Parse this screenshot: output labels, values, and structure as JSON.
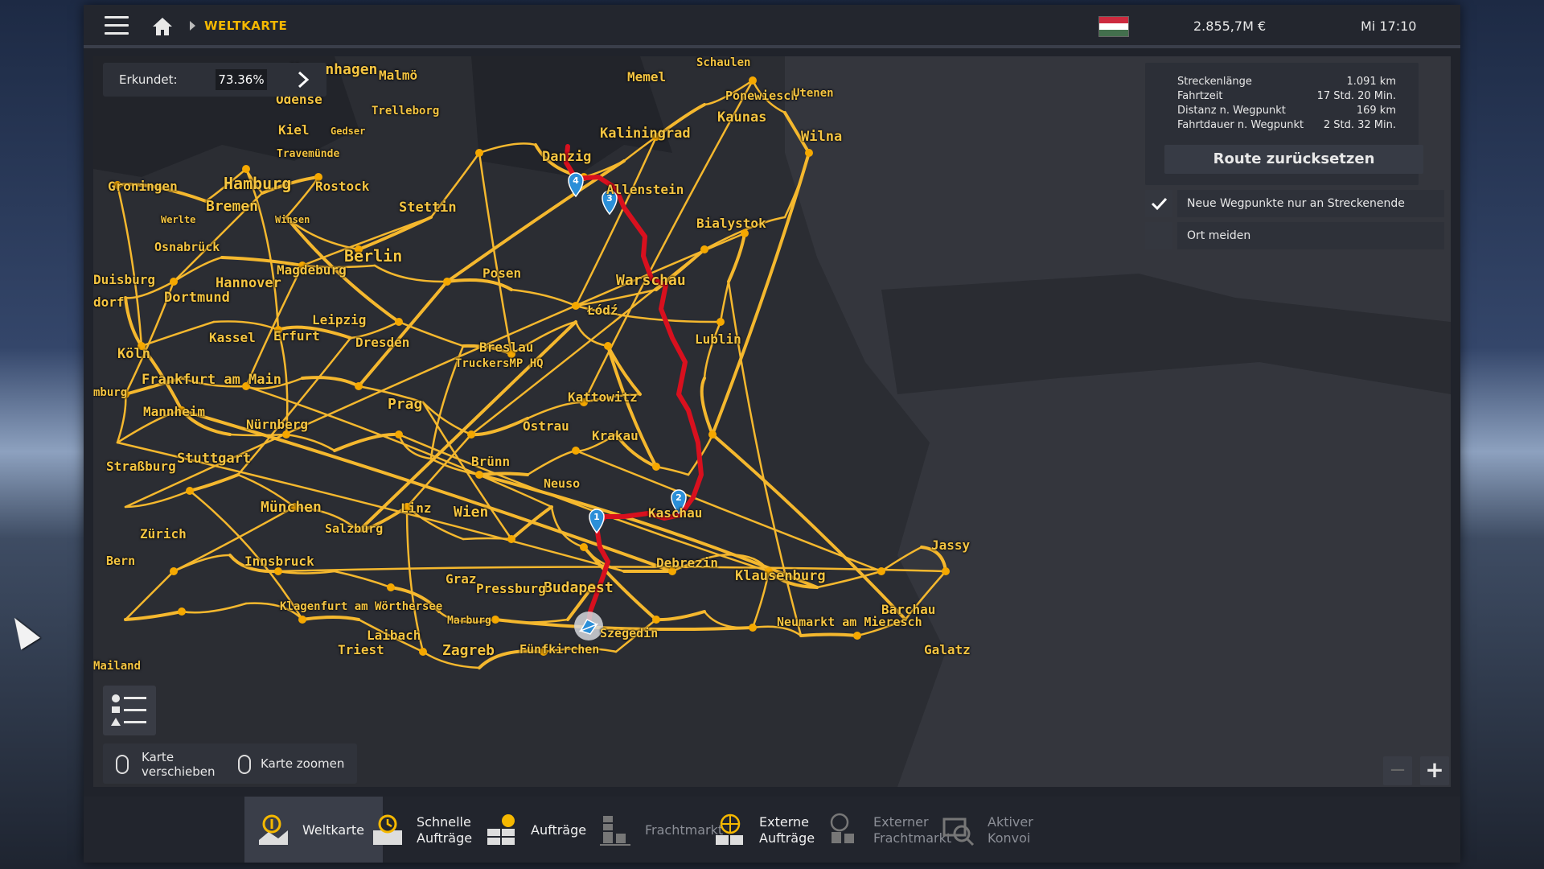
{
  "topbar": {
    "breadcrumb": "WELTKARTE",
    "money": "2.855,7M €",
    "clock": "Mi 17:10",
    "flag_colors": [
      "#cd2a3e",
      "#ffffff",
      "#436f4d"
    ]
  },
  "explored": {
    "label": "Erkundet:",
    "value": "73.36%"
  },
  "route": {
    "rows": [
      {
        "k": "Streckenlänge",
        "v": "1.091 km"
      },
      {
        "k": "Fahrtzeit",
        "v": "17 Std. 20 Min."
      },
      {
        "k": "Distanz n. Wegpunkt",
        "v": "169 km"
      },
      {
        "k": "Fahrtdauer n. Wegpunkt",
        "v": "2 Std. 32 Min."
      }
    ],
    "reset_label": "Route zurücksetzen"
  },
  "options": [
    {
      "label": "Neue Wegpunkte nur an Streckenende setzen",
      "checked": true
    },
    {
      "label": "Ort meiden",
      "checked": false
    }
  ],
  "hints": {
    "move": "Karte\nverschieben",
    "zoom": "Karte zoomen"
  },
  "zoom": {
    "minus": "−",
    "plus": "+"
  },
  "waypoints": [
    "1",
    "2",
    "3",
    "4"
  ],
  "cities": [
    {
      "n": "Kopenhagen",
      "s": 18
    },
    {
      "n": "Malmö",
      "s": 16
    },
    {
      "n": "Odense",
      "s": 16
    },
    {
      "n": "Trelleborg",
      "s": 14
    },
    {
      "n": "Kiel",
      "s": 16
    },
    {
      "n": "Gedser",
      "s": 12
    },
    {
      "n": "Travemünde",
      "s": 13
    },
    {
      "n": "Hamburg",
      "s": 20
    },
    {
      "n": "Rostock",
      "s": 16
    },
    {
      "n": "Groningen",
      "s": 16
    },
    {
      "n": "Bremen",
      "s": 18
    },
    {
      "n": "Werlte",
      "s": 12
    },
    {
      "n": "Winsen",
      "s": 12
    },
    {
      "n": "Stettin",
      "s": 17
    },
    {
      "n": "Osnabrück",
      "s": 15
    },
    {
      "n": "Berlin",
      "s": 20
    },
    {
      "n": "Duisburg",
      "s": 16
    },
    {
      "n": "Hannover",
      "s": 17
    },
    {
      "n": "Magdeburg",
      "s": 16
    },
    {
      "n": "Dortmund",
      "s": 17
    },
    {
      "n": "dorf",
      "s": 16
    },
    {
      "n": "Leipzig",
      "s": 16
    },
    {
      "n": "Kassel",
      "s": 16
    },
    {
      "n": "Erfurt",
      "s": 16
    },
    {
      "n": "Dresden",
      "s": 16
    },
    {
      "n": "Köln",
      "s": 17
    },
    {
      "n": "Frankfurt am Main",
      "s": 17
    },
    {
      "n": "mburg",
      "s": 14
    },
    {
      "n": "Mannheim",
      "s": 16
    },
    {
      "n": "Nürnberg",
      "s": 16
    },
    {
      "n": "Prag",
      "s": 18
    },
    {
      "n": "Straßburg",
      "s": 16
    },
    {
      "n": "Stuttgart",
      "s": 17
    },
    {
      "n": "München",
      "s": 18
    },
    {
      "n": "Linz",
      "s": 16
    },
    {
      "n": "Zürich",
      "s": 16
    },
    {
      "n": "Salzburg",
      "s": 15
    },
    {
      "n": "Wien",
      "s": 18
    },
    {
      "n": "Innsbruck",
      "s": 16
    },
    {
      "n": "Bern",
      "s": 15
    },
    {
      "n": "Graz",
      "s": 16
    },
    {
      "n": "Klagenfurt am Wörthersee",
      "s": 14
    },
    {
      "n": "Marburg",
      "s": 13
    },
    {
      "n": "Laibach",
      "s": 16
    },
    {
      "n": "Triest",
      "s": 16
    },
    {
      "n": "Zagreb",
      "s": 18
    },
    {
      "n": "Fünfkirchen",
      "s": 15
    },
    {
      "n": "Szegedin",
      "s": 15
    },
    {
      "n": "Budapest",
      "s": 18
    },
    {
      "n": "Debrezin",
      "s": 16
    },
    {
      "n": "Pressburg",
      "s": 16
    },
    {
      "n": "Brünn",
      "s": 16
    },
    {
      "n": "Neuso",
      "s": 15
    },
    {
      "n": "Kaschau",
      "s": 16
    },
    {
      "n": "Ostrau",
      "s": 16
    },
    {
      "n": "Krakau",
      "s": 16
    },
    {
      "n": "Kattowitz",
      "s": 16
    },
    {
      "n": "Breslau",
      "s": 16
    },
    {
      "n": "TruckersMP HQ",
      "s": 14
    },
    {
      "n": "Posen",
      "s": 16
    },
    {
      "n": "Łódź",
      "s": 16
    },
    {
      "n": "Warschau",
      "s": 18
    },
    {
      "n": "Lublin",
      "s": 16
    },
    {
      "n": "Bialystok",
      "s": 16
    },
    {
      "n": "Allenstein",
      "s": 16
    },
    {
      "n": "Danzig",
      "s": 17
    },
    {
      "n": "Kaliningrad",
      "s": 17
    },
    {
      "n": "Memel",
      "s": 16
    },
    {
      "n": "Schaulen",
      "s": 14
    },
    {
      "n": "Ponewiesch",
      "s": 15
    },
    {
      "n": "Utenen",
      "s": 14
    },
    {
      "n": "Kaunas",
      "s": 17
    },
    {
      "n": "Wilna",
      "s": 17
    },
    {
      "n": "Klausenburg",
      "s": 17
    },
    {
      "n": "Jassy",
      "s": 16
    },
    {
      "n": "Barchau",
      "s": 16
    },
    {
      "n": "Neumarkt am Mieresch",
      "s": 15
    },
    {
      "n": "Galatz",
      "s": 16
    },
    {
      "n": "Mailand",
      "s": 14
    }
  ],
  "tabs": [
    {
      "label": "Weltkarte",
      "icon": "world-map-icon",
      "active": true,
      "dim": false
    },
    {
      "label": "Schnelle\nAufträge",
      "icon": "quick-jobs-icon",
      "active": false,
      "dim": false
    },
    {
      "label": "Aufträge",
      "icon": "jobs-icon",
      "active": false,
      "dim": false
    },
    {
      "label": "Frachtmarkt",
      "icon": "cargo-market-icon",
      "active": false,
      "dim": true
    },
    {
      "label": "Externe\nAufträge",
      "icon": "external-jobs-icon",
      "active": false,
      "dim": false
    },
    {
      "label": "Externer\nFrachtmarkt",
      "icon": "external-cargo-market-icon",
      "active": false,
      "dim": true
    },
    {
      "label": "Aktiver\nKonvoi",
      "icon": "convoy-icon",
      "active": false,
      "dim": true
    }
  ],
  "colors": {
    "road": "#f5b82e",
    "route": "#d8101e",
    "accent": "#f5b800",
    "waypoint": "#2b8fd8"
  }
}
